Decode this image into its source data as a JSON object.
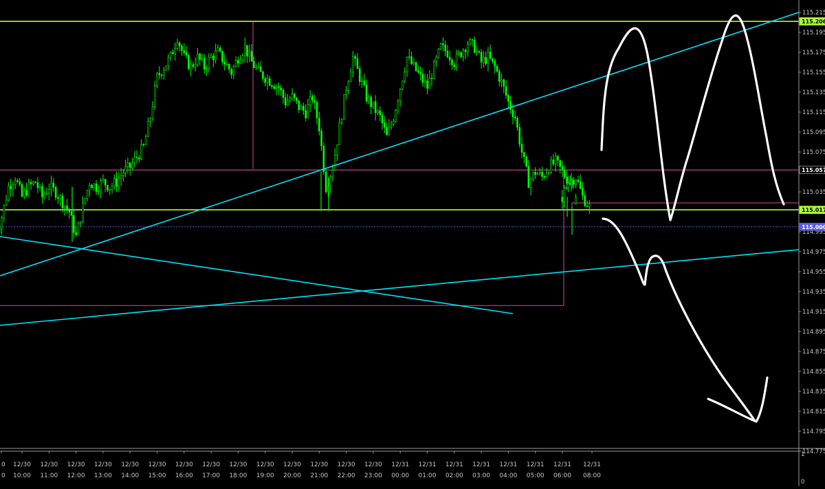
{
  "colors": {
    "background": "#000000",
    "candle": "#00ff00",
    "level_line": "#adff2f",
    "trend_line": "#00e5ff",
    "box": "#d34d9a",
    "dotted_level": "#5a5ae6",
    "drawing": "#ffffff",
    "axis_text": "#c8c8c8"
  },
  "chart_data": {
    "type": "candlestick",
    "title": "",
    "xlabel": "",
    "ylabel": "",
    "ylim": [
      114.765,
      115.223
    ],
    "grid": false,
    "y_ticks": [
      "115.215",
      "115.195",
      "115.175",
      "115.155",
      "115.135",
      "115.115",
      "115.095",
      "115.075",
      "115.055",
      "115.035",
      "115.015",
      "114.995",
      "114.975",
      "114.955",
      "114.935",
      "114.915",
      "114.895",
      "114.875",
      "114.855",
      "114.835",
      "114.815",
      "114.795",
      "114.775"
    ],
    "x_ticks": [
      {
        "date": "0",
        "time": "0"
      },
      {
        "date": "12/30",
        "time": "10:00"
      },
      {
        "date": "12/30",
        "time": "11:00"
      },
      {
        "date": "12/30",
        "time": "12:00"
      },
      {
        "date": "12/30",
        "time": "13:00"
      },
      {
        "date": "12/30",
        "time": "14:00"
      },
      {
        "date": "12/30",
        "time": "15:00"
      },
      {
        "date": "12/30",
        "time": "16:00"
      },
      {
        "date": "12/30",
        "time": "17:00"
      },
      {
        "date": "12/30",
        "time": "18:00"
      },
      {
        "date": "12/30",
        "time": "19:00"
      },
      {
        "date": "12/30",
        "time": "20:00"
      },
      {
        "date": "12/30",
        "time": "21:00"
      },
      {
        "date": "12/30",
        "time": "22:00"
      },
      {
        "date": "12/30",
        "time": "23:00"
      },
      {
        "date": "12/31",
        "time": "00:00"
      },
      {
        "date": "12/31",
        "time": "01:00"
      },
      {
        "date": "12/31",
        "time": "02:00"
      },
      {
        "date": "12/31",
        "time": "03:00"
      },
      {
        "date": "12/31",
        "time": "04:00"
      },
      {
        "date": "12/31",
        "time": "05:00"
      },
      {
        "date": "12/31",
        "time": "06:00"
      },
      {
        "date": "12/31",
        "time": "08:00"
      }
    ],
    "close_series": [
      [
        "09:00",
        114.99
      ],
      [
        "09:15",
        115.01
      ],
      [
        "09:30",
        115.04
      ],
      [
        "09:45",
        115.05
      ],
      [
        "10:00",
        115.03
      ],
      [
        "10:15",
        115.04
      ],
      [
        "10:30",
        115.045
      ],
      [
        "10:45",
        115.03
      ],
      [
        "11:00",
        115.04
      ],
      [
        "11:15",
        115.035
      ],
      [
        "11:30",
        115.025
      ],
      [
        "11:45",
        115.015
      ],
      [
        "12:00",
        114.99
      ],
      [
        "12:15",
        115.02
      ],
      [
        "12:30",
        115.045
      ],
      [
        "12:45",
        115.04
      ],
      [
        "13:00",
        115.045
      ],
      [
        "13:15",
        115.04
      ],
      [
        "13:30",
        115.045
      ],
      [
        "13:45",
        115.055
      ],
      [
        "14:00",
        115.06
      ],
      [
        "14:15",
        115.07
      ],
      [
        "14:30",
        115.08
      ],
      [
        "14:45",
        115.11
      ],
      [
        "15:00",
        115.15
      ],
      [
        "15:15",
        115.16
      ],
      [
        "15:30",
        115.17
      ],
      [
        "15:45",
        115.19
      ],
      [
        "16:00",
        115.17
      ],
      [
        "16:15",
        115.16
      ],
      [
        "16:30",
        115.17
      ],
      [
        "16:45",
        115.16
      ],
      [
        "17:00",
        115.17
      ],
      [
        "17:15",
        115.175
      ],
      [
        "17:30",
        115.165
      ],
      [
        "17:45",
        115.155
      ],
      [
        "18:00",
        115.17
      ],
      [
        "18:15",
        115.18
      ],
      [
        "18:30",
        115.165
      ],
      [
        "18:45",
        115.155
      ],
      [
        "19:00",
        115.15
      ],
      [
        "19:15",
        115.145
      ],
      [
        "19:30",
        115.14
      ],
      [
        "19:45",
        115.125
      ],
      [
        "20:00",
        115.13
      ],
      [
        "20:15",
        115.12
      ],
      [
        "20:30",
        115.115
      ],
      [
        "20:45",
        115.13
      ],
      [
        "21:00",
        115.1
      ],
      [
        "21:15",
        115.04
      ],
      [
        "21:30",
        115.06
      ],
      [
        "21:45",
        115.1
      ],
      [
        "22:00",
        115.14
      ],
      [
        "22:15",
        115.17
      ],
      [
        "22:30",
        115.15
      ],
      [
        "22:45",
        115.13
      ],
      [
        "23:00",
        115.12
      ],
      [
        "23:15",
        115.11
      ],
      [
        "23:30",
        115.09
      ],
      [
        "23:45",
        115.11
      ],
      [
        "00:00",
        115.14
      ],
      [
        "00:15",
        115.17
      ],
      [
        "00:30",
        115.16
      ],
      [
        "00:45",
        115.15
      ],
      [
        "01:00",
        115.14
      ],
      [
        "01:15",
        115.16
      ],
      [
        "01:30",
        115.18
      ],
      [
        "01:45",
        115.175
      ],
      [
        "02:00",
        115.165
      ],
      [
        "02:15",
        115.175
      ],
      [
        "02:30",
        115.185
      ],
      [
        "02:45",
        115.18
      ],
      [
        "03:00",
        115.165
      ],
      [
        "03:15",
        115.17
      ],
      [
        "03:30",
        115.16
      ],
      [
        "03:45",
        115.145
      ],
      [
        "04:00",
        115.125
      ],
      [
        "04:15",
        115.11
      ],
      [
        "04:30",
        115.075
      ],
      [
        "04:45",
        115.045
      ],
      [
        "05:00",
        115.055
      ],
      [
        "05:15",
        115.05
      ],
      [
        "05:30",
        115.06
      ],
      [
        "05:45",
        115.065
      ],
      [
        "06:00",
        115.055
      ],
      [
        "06:15",
        115.045
      ],
      [
        "06:30",
        115.05
      ],
      [
        "06:45",
        115.03
      ],
      [
        "07:00",
        115.02
      ],
      [
        "07:15",
        115.03
      ],
      [
        "07:30",
        115.04
      ],
      [
        "07:45",
        115.05
      ],
      [
        "08:00",
        115.055
      ]
    ],
    "price_labels": {
      "upper_level": "115.206",
      "box_top": "115.057",
      "lower_level": "115.017",
      "round_level": "115.000"
    },
    "side_scale": {
      "top": "1",
      "bottom": "0"
    }
  }
}
